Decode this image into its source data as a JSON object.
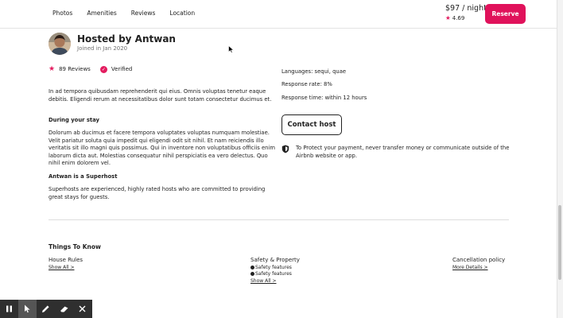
{
  "header": {
    "nav": [
      "Photos",
      "Amenities",
      "Reviews",
      "Location"
    ],
    "price": "$97 / night",
    "rating": "4.69",
    "reserve_label": "Reserve"
  },
  "host": {
    "name": "Hosted by Antwan",
    "joined": "Joined in Jan 2020",
    "reviews": "89 Reviews",
    "verified": "Verified",
    "description": "In ad tempora quibusdam reprehenderit qui eius. Omnis voluptas tenetur eaque debitis. Eligendi rerum at necessitatibus dolor sunt totam consectetur ducimus et.",
    "during_stay_title": "During your stay",
    "during_stay_text": "Dolorum ab ducimus et facere tempora voluptates voluptas numquam molestiae. Velit pariatur soluta quia impedit qui eligendi odit sit nihil. Et nam reiciendis illo veritatis sit illo magni quis possimus. Qui in inventore non voluptatibus officiis enim laborum dicta aut. Molestias consequatur nihil perspiciatis ea vero delectus. Quo nihil enim dolorem vel.",
    "superhost_title": "Antwan is a Superhost",
    "superhost_text": "Superhosts are experienced, highly rated hosts who are committed to providing great stays for guests.",
    "languages": "Languages: sequi, quae",
    "response_rate": "Response rate: 8%",
    "response_time": "Response time: within 12 hours",
    "contact_label": "Contact host",
    "protect_text": "To Protect your payment, never transfer money or communicate outside of the Airbnb website or app."
  },
  "things": {
    "title": "Things To Know",
    "house_rules": {
      "title": "House Rules",
      "link": "Show All >"
    },
    "safety": {
      "title": "Safety & Property",
      "features": [
        "Safety features",
        "Safety features"
      ],
      "link": "Show All >"
    },
    "cancellation": {
      "title": "Cancellation policy",
      "link": "More Details >"
    }
  },
  "colors": {
    "accent": "#e31c5f",
    "reserve_bg": "#e0125b",
    "toolbar_bg": "#2f2f2f"
  },
  "toolbar": {
    "icons": [
      "pause-icon",
      "pointer-icon",
      "pencil-icon",
      "eraser-icon",
      "close-icon"
    ]
  }
}
